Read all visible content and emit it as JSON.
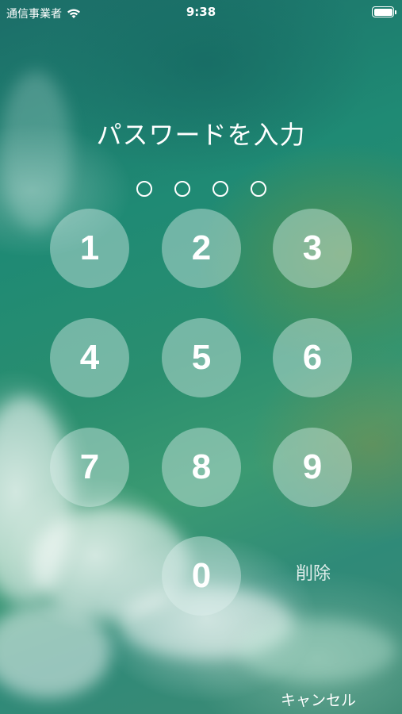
{
  "status_bar": {
    "carrier": "通信事業者",
    "wifi_icon": "wifi-icon",
    "time": "9:38",
    "battery_icon": "battery-icon"
  },
  "title": "パスワードを入力",
  "passcode_dots": 4,
  "keypad": {
    "keys": [
      "1",
      "2",
      "3",
      "4",
      "5",
      "6",
      "7",
      "8",
      "9",
      "0"
    ],
    "delete_label": "削除"
  },
  "cancel_label": "キャンセル"
}
